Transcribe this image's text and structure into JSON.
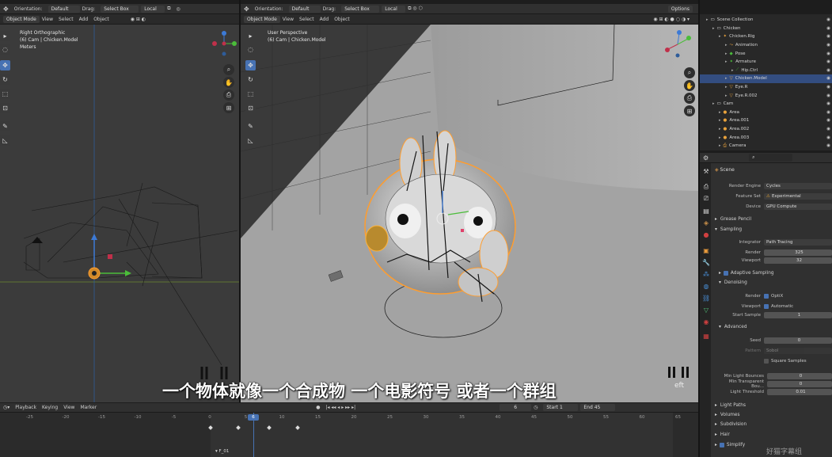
{
  "left_header": {
    "orientation_label": "Orientation:",
    "orientation_value": "Default",
    "drag_label": "Drag:",
    "drag_value": "Select Box",
    "pivot_value": "Local"
  },
  "left_menu": {
    "mode": "Object Mode",
    "items": [
      "View",
      "Select",
      "Add",
      "Object"
    ]
  },
  "left_viewport": {
    "view_name": "Right Orthographic",
    "collection": "(6) Cam | Chicken.Model",
    "units": "Meters"
  },
  "center_header": {
    "orientation_label": "Orientation:",
    "orientation_value": "Default",
    "drag_label": "Drag:",
    "drag_value": "Select Box",
    "pivot_value": "Local",
    "options_label": "Options"
  },
  "center_menu": {
    "mode": "Object Mode",
    "items": [
      "View",
      "Select",
      "Add",
      "Object"
    ]
  },
  "center_viewport": {
    "view_name": "User Perspective",
    "collection": "(6) Cam | Chicken.Model",
    "watermark": "eft"
  },
  "subtitle": "一个物体就像一个合成物 一个电影符号 或者一个群组",
  "outliner": {
    "rows": [
      {
        "label": "Scene Collection",
        "icon": "collection-icon",
        "indent": 0
      },
      {
        "label": "Chicken",
        "icon": "collection-icon",
        "indent": 1
      },
      {
        "label": "Chicken.Rig",
        "icon": "armature-icon",
        "indent": 2
      },
      {
        "label": "Animation",
        "icon": "action-icon",
        "indent": 3
      },
      {
        "label": "Pose",
        "icon": "pose-icon",
        "indent": 3
      },
      {
        "label": "Armature",
        "icon": "armature-data-icon",
        "indent": 3
      },
      {
        "label": "Hip.Ctrl",
        "icon": "bone-icon",
        "indent": 4
      },
      {
        "label": "Chicken.Model",
        "icon": "mesh-icon",
        "indent": 3,
        "selected": true
      },
      {
        "label": "Eye.R",
        "icon": "mesh-icon",
        "indent": 3
      },
      {
        "label": "Eye.R.002",
        "icon": "mesh-icon",
        "indent": 3
      },
      {
        "label": "Cam",
        "icon": "collection-icon",
        "indent": 1
      },
      {
        "label": "Area",
        "icon": "light-icon",
        "indent": 2
      },
      {
        "label": "Area.001",
        "icon": "light-icon",
        "indent": 2
      },
      {
        "label": "Area.002",
        "icon": "light-icon",
        "indent": 2
      },
      {
        "label": "Area.003",
        "icon": "light-icon",
        "indent": 2
      },
      {
        "label": "Camera",
        "icon": "camera-icon",
        "indent": 2
      }
    ]
  },
  "properties": {
    "context": "Scene",
    "render_engine_label": "Render Engine",
    "render_engine": "Cycles",
    "feature_set_label": "Feature Set",
    "feature_set": "Experimental",
    "device_label": "Device",
    "device": "GPU Compute",
    "grease_pencil": "Grease Pencil",
    "sampling": "Sampling",
    "integrator_label": "Integrator",
    "integrator": "Path Tracing",
    "render_label": "Render",
    "render_samples": "325",
    "viewport_label": "Viewport",
    "viewport_samples": "32",
    "adaptive_sampling": "Adaptive Sampling",
    "denoising": "Denoising",
    "denoise_render_label": "Render",
    "denoise_render": "OptiX",
    "denoise_viewport_label": "Viewport",
    "denoise_viewport": "Automatic",
    "start_sample_label": "Start Sample",
    "start_sample": "1",
    "advanced": "Advanced",
    "seed_label": "Seed",
    "seed": "0",
    "pattern_label": "Pattern",
    "pattern": "Sobol",
    "square_samples": "Square Samples",
    "min_light_bounces_label": "Min Light Bounces",
    "min_light_bounces": "0",
    "min_transparent_label": "Min Transparent Bou...",
    "min_transparent": "0",
    "light_threshold_label": "Light Threshold",
    "light_threshold": "0.01",
    "light_paths": "Light Paths",
    "volumes": "Volumes",
    "subdivision": "Subdivision",
    "hair": "Hair",
    "simplify": "Simplify",
    "watermark": "好猫字幕组"
  },
  "timeline": {
    "menu": [
      "Playback",
      "Keying",
      "View",
      "Marker"
    ],
    "current_frame": "6",
    "start_label": "Start",
    "start": "1",
    "end_label": "End",
    "end": "45",
    "ticks": [
      "-25",
      "-20",
      "-15",
      "-10",
      "-5",
      "0",
      "5",
      "10",
      "15",
      "20",
      "25",
      "30",
      "35",
      "40",
      "45",
      "50",
      "55",
      "60",
      "65"
    ],
    "marker_label": "F_01"
  }
}
